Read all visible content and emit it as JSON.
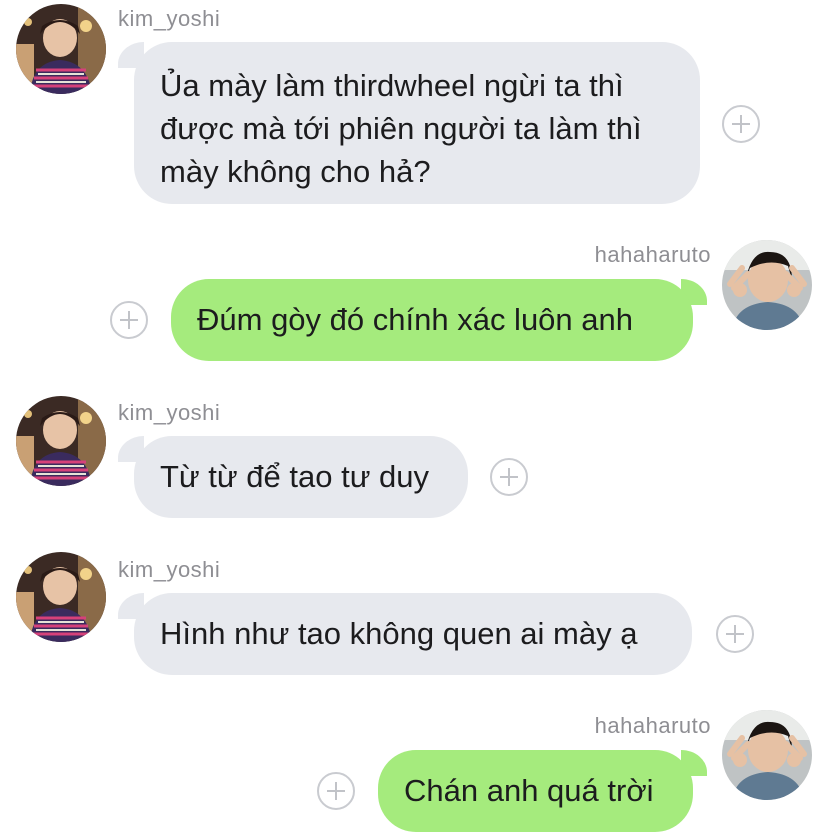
{
  "messages": [
    {
      "sender": "kim_yoshi",
      "direction": "incoming",
      "lines": [
        "Ủa mày làm thirdwheel ngừi ta thì",
        "được mà tới phiên người ta làm thì",
        "mày không cho hả?"
      ]
    },
    {
      "sender": "hahaharuto",
      "direction": "outgoing",
      "lines": [
        "Đúm gòy đó chính xác luôn anh"
      ]
    },
    {
      "sender": "kim_yoshi",
      "direction": "incoming",
      "lines": [
        "Từ từ để tao tư duy"
      ]
    },
    {
      "sender": "kim_yoshi",
      "direction": "incoming",
      "lines": [
        "Hình như tao không quen ai mày ạ"
      ]
    },
    {
      "sender": "hahaharuto",
      "direction": "outgoing",
      "lines": [
        "Chán anh quá trời"
      ]
    }
  ],
  "icons": {
    "reaction": "plus-circle-icon",
    "avatar_incoming": "avatar-kim-yoshi",
    "avatar_outgoing": "avatar-hahaharuto"
  },
  "colors": {
    "incoming_bubble": "#e7e9ee",
    "outgoing_bubble": "#a5eb7d",
    "username": "#8e8e93",
    "text": "#1c1c1e"
  }
}
